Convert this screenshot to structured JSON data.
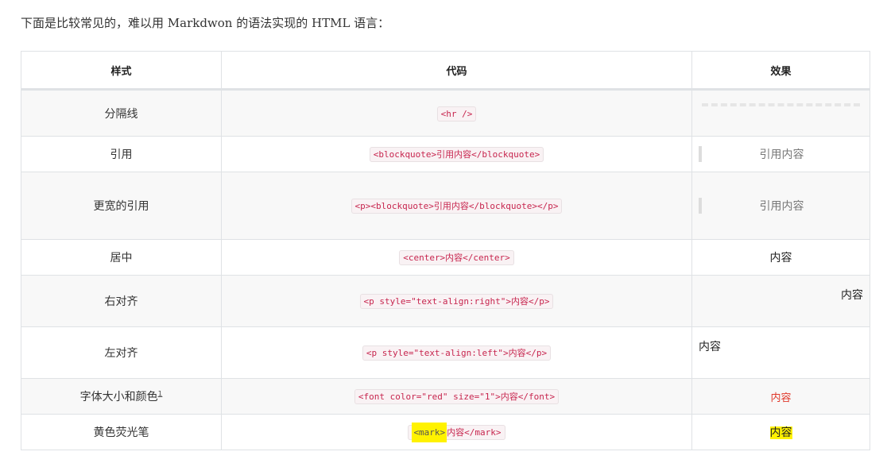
{
  "intro": "下面是比较常见的，难以用 Markdwon 的语法实现的 HTML 语言：",
  "headers": {
    "style": "样式",
    "code": "代码",
    "effect": "效果"
  },
  "rows": [
    {
      "style": "分隔线",
      "code": "<hr />",
      "effect": ""
    },
    {
      "style": "引用",
      "code": "<blockquote>引用内容</blockquote>",
      "effect": "引用内容"
    },
    {
      "style": "更宽的引用",
      "code": "<p><blockquote>引用内容</blockquote></p>",
      "effect": "引用内容"
    },
    {
      "style": "居中",
      "code": "<center>内容</center>",
      "effect": "内容"
    },
    {
      "style": "右对齐",
      "code": "<p style=\"text-align:right\">内容</p>",
      "effect": "内容"
    },
    {
      "style": "左对齐",
      "code": "<p style=\"text-align:left\">内容</p>",
      "effect": "内容"
    },
    {
      "style": "字体大小和颜色",
      "style_sup": "1",
      "code": "<font color=\"red\" size=\"1\">内容</font>",
      "effect": "内容"
    },
    {
      "style": "黄色荧光笔",
      "code_mark": "<mark>",
      "code_rest": "内容</mark>",
      "effect": "内容"
    }
  ],
  "colors": {
    "red_text": "#e0392b",
    "highlight": "#fff200",
    "code_text": "#c7254e"
  }
}
